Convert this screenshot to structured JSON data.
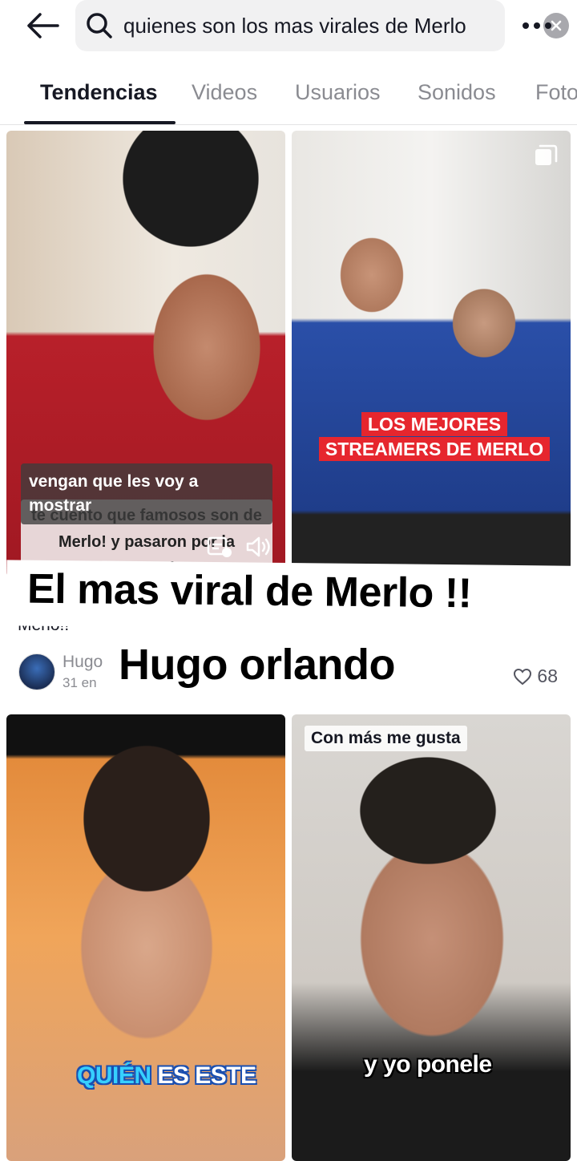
{
  "header": {
    "back_icon": "arrow-left-icon",
    "search_icon": "search-icon",
    "search_value": "quienes son los mas virales de Merlo",
    "clear_icon": "clear-icon",
    "more_icon": "more-icon"
  },
  "tabs": [
    {
      "label": "Tendencias",
      "active": true
    },
    {
      "label": "Videos",
      "active": false
    },
    {
      "label": "Usuarios",
      "active": false
    },
    {
      "label": "Sonidos",
      "active": false
    },
    {
      "label": "Fotos",
      "active": false
    }
  ],
  "results": [
    {
      "caption_top": "vengan que les voy a mostrar",
      "caption_sub": "te cuento que famosos son de Merlo! y pasaron por la peluquería!!",
      "title": "Merlo!! ",
      "author": "Hugo",
      "date": "31 en",
      "likes": "68"
    },
    {
      "caption_lines": [
        "LOS MEJORES",
        "STREAMERS DE MERLO"
      ],
      "multi_image_icon": "multi-image-icon"
    },
    {
      "caption_hl": "QUIÉN",
      "caption_rest": " ES ESTE"
    },
    {
      "top_label": "Con más me gusta",
      "caption": "y yo ponele"
    }
  ],
  "overlay": {
    "line1": "El mas viral de Merlo !!",
    "line2": "Hugo orlando"
  },
  "colors": {
    "accent_red": "#e6262e",
    "text_primary": "#161823",
    "text_secondary": "#8a8b91"
  }
}
